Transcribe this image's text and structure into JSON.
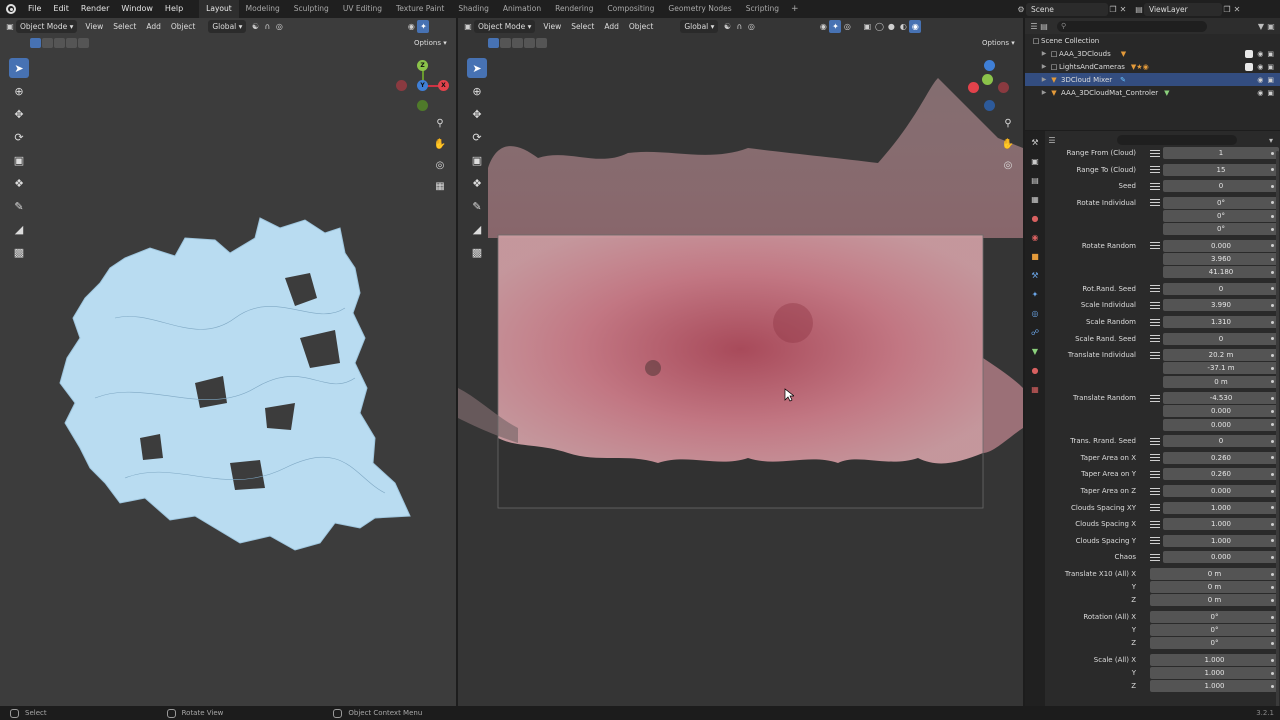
{
  "menu": {
    "items": [
      "File",
      "Edit",
      "Render",
      "Window",
      "Help"
    ],
    "workspaces": [
      "Layout",
      "Modeling",
      "Sculpting",
      "UV Editing",
      "Texture Paint",
      "Shading",
      "Animation",
      "Rendering",
      "Compositing",
      "Geometry Nodes",
      "Scripting"
    ],
    "active_workspace": "Layout",
    "add_tab": "+",
    "scene_name": "Scene",
    "view_layer": "ViewLayer"
  },
  "viewport_left": {
    "mode": "Object Mode",
    "menus": [
      "View",
      "Select",
      "Add",
      "Object"
    ],
    "orientation": "Global",
    "options_label": "Options"
  },
  "viewport_right": {
    "mode": "Object Mode",
    "menus": [
      "View",
      "Select",
      "Add",
      "Object"
    ],
    "orientation": "Global",
    "options_label": "Options"
  },
  "gizmo_labels": {
    "z": "Z",
    "x": "X",
    "y": "Y"
  },
  "outliner": {
    "root": "Scene Collection",
    "rows": [
      {
        "name": "AAA_3DClouds",
        "selected": false
      },
      {
        "name": "LightsAndCameras",
        "selected": false
      },
      {
        "name": "3DCloud Mixer",
        "selected": true
      },
      {
        "name": "AAA_3DCloudMat_Controler",
        "selected": false
      }
    ]
  },
  "properties": {
    "rows": [
      {
        "label": "Range From (Cloud)",
        "value": "1",
        "grip": true
      },
      {
        "label": "Range To (Cloud)",
        "value": "15",
        "grip": true
      },
      {
        "label": "Seed",
        "value": "0",
        "grip": true
      },
      {
        "label": "Rotate Individual",
        "value": "0°",
        "grip": true
      },
      {
        "label": "",
        "value": "0°",
        "grip": false
      },
      {
        "label": "",
        "value": "0°",
        "grip": false
      },
      {
        "label": "Rotate Random",
        "value": "0.000",
        "grip": true
      },
      {
        "label": "",
        "value": "3.960",
        "grip": false
      },
      {
        "label": "",
        "value": "41.180",
        "grip": false
      },
      {
        "label": "Rot.Rand. Seed",
        "value": "0",
        "grip": true
      },
      {
        "label": "Scale Individual",
        "value": "3.990",
        "grip": true
      },
      {
        "label": "Scale Random",
        "value": "1.310",
        "grip": true
      },
      {
        "label": "Scale Rand. Seed",
        "value": "0",
        "grip": true
      },
      {
        "label": "Translate Individual",
        "value": "20.2 m",
        "grip": true
      },
      {
        "label": "",
        "value": "-37.1 m",
        "grip": false
      },
      {
        "label": "",
        "value": "0 m",
        "grip": false
      },
      {
        "label": "Translate Random",
        "value": "-4.530",
        "grip": true
      },
      {
        "label": "",
        "value": "0.000",
        "grip": false
      },
      {
        "label": "",
        "value": "0.000",
        "grip": false
      },
      {
        "label": "Trans. Rrand. Seed",
        "value": "0",
        "grip": true
      },
      {
        "label": "Taper Area on X",
        "value": "0.260",
        "grip": true
      },
      {
        "label": "Taper Area on Y",
        "value": "0.260",
        "grip": true
      },
      {
        "label": "Taper Area on Z",
        "value": "0.000",
        "grip": true
      },
      {
        "label": "Clouds Spacing XY",
        "value": "1.000",
        "grip": true
      },
      {
        "label": "Clouds Spacing X",
        "value": "1.000",
        "grip": true
      },
      {
        "label": "Clouds Spacing Y",
        "value": "1.000",
        "grip": true
      },
      {
        "label": "Chaos",
        "value": "0.000",
        "grip": true
      },
      {
        "label": "Translate X10 (All) X",
        "value": "0 m",
        "grip": false
      },
      {
        "label": "Y",
        "value": "0 m",
        "grip": false
      },
      {
        "label": "Z",
        "value": "0 m",
        "grip": false
      },
      {
        "label": "Rotation (All) X",
        "value": "0°",
        "grip": false
      },
      {
        "label": "Y",
        "value": "0°",
        "grip": false
      },
      {
        "label": "Z",
        "value": "0°",
        "grip": false
      },
      {
        "label": "Scale (All) X",
        "value": "1.000",
        "grip": false
      },
      {
        "label": "Y",
        "value": "1.000",
        "grip": false
      },
      {
        "label": "Z",
        "value": "1.000",
        "grip": false
      }
    ]
  },
  "status": {
    "select": "Select",
    "rotate_view": "Rotate View",
    "context_menu": "Object Context Menu",
    "version": "3.2.1"
  },
  "colors": {
    "accent": "#4772b3",
    "cloud_mesh": "#b9dcf1",
    "cloud_render": "#c98a93",
    "selected_row": "#334d80"
  }
}
